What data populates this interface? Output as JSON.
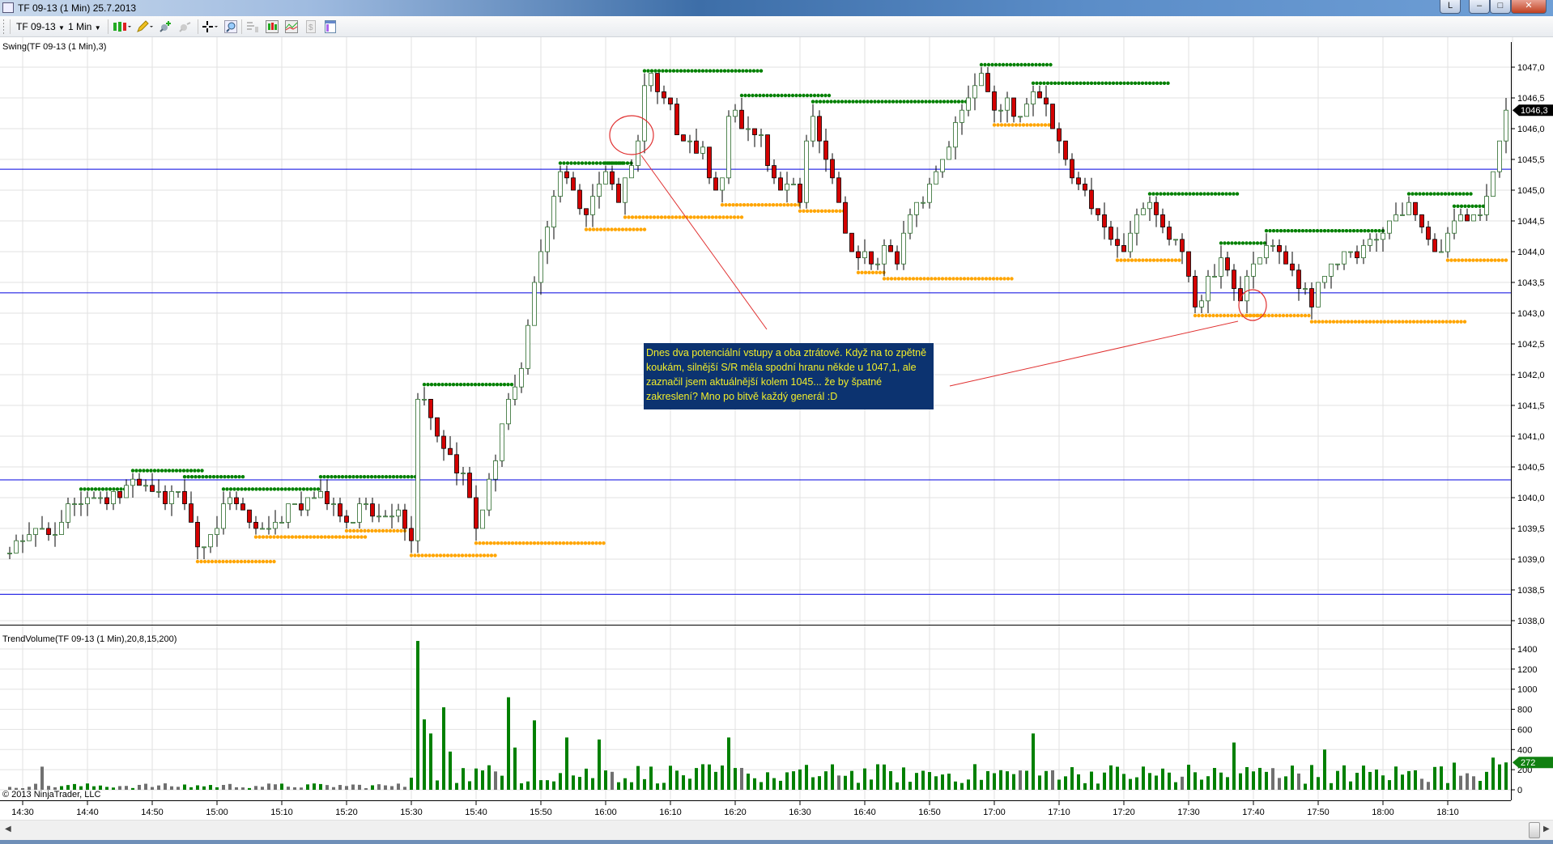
{
  "window": {
    "title": "TF 09-13 (1 Min)  25.7.2013",
    "btn_l": "L",
    "minimize": "–",
    "maximize": "□",
    "close": "✕"
  },
  "toolbar": {
    "instrument": "TF 09-13",
    "interval": "1 Min",
    "icons": [
      "bar-type-icon",
      "drawing-pencil-icon",
      "add-indicator-icon",
      "strategy-icon",
      "crosshair-icon",
      "zoom-icon",
      "data-box-icon",
      "chart-style-icon",
      "indicators-icon",
      "order-icon",
      "properties-icon"
    ]
  },
  "price_panel": {
    "label": "Swing(TF 09-13 (1 Min),3)",
    "last_price": "1046,3",
    "ticks": [
      "1047,0",
      "1046,5",
      "1046,0",
      "1045,5",
      "1045,0",
      "1044,5",
      "1044,0",
      "1043,5",
      "1043,0",
      "1042,5",
      "1042,0",
      "1041,5",
      "1041,0",
      "1040,5",
      "1040,0",
      "1039,5",
      "1039,0",
      "1038,5",
      "1038,0"
    ]
  },
  "volume_panel": {
    "label": "TrendVolume(TF 09-13 (1 Min),20,8,15,200)",
    "last_value": "272",
    "ticks": [
      "1400",
      "1200",
      "1000",
      "800",
      "600",
      "400",
      "200",
      "0"
    ]
  },
  "copyright": "© 2013 NinjaTrader, LLC",
  "time_axis": [
    "14:30",
    "14:40",
    "14:50",
    "15:00",
    "15:10",
    "15:20",
    "15:30",
    "15:40",
    "15:50",
    "16:00",
    "16:10",
    "16:20",
    "16:30",
    "16:40",
    "16:50",
    "17:00",
    "17:10",
    "17:20",
    "17:30",
    "17:40",
    "17:50",
    "18:00",
    "18:10"
  ],
  "annotation": "Dnes dva potenciální vstupy a oba ztrátové. Když na to zpětně koukám, silnější S/R měla spodní hranu někde u 1047,1, ale zaznačil jsem aktuálnější kolem 1045... že by špatné zakreslení? Mno po bitvě každý generál :D",
  "colors": {
    "up": "#ffffff",
    "down": "#d40000",
    "swing_high": "#008000",
    "swing_low": "#ffa500",
    "sr_line": "#0000e0",
    "vol_trend": "#008000",
    "vol_neutral": "#707070",
    "note_bg": "#0c3370",
    "note_text": "#f2ee2a"
  },
  "chart_data": {
    "type": "candlestick",
    "start_time": "14:28",
    "end_time": "18:19",
    "bar_minutes": 1,
    "price_range": [
      1038.0,
      1047.0
    ],
    "sr_levels": [
      1045.34,
      1043.33,
      1040.29,
      1038.43
    ],
    "close_keypoints_minute_price": [
      [
        -2,
        1039.1
      ],
      [
        0,
        1039.3
      ],
      [
        3,
        1039.5
      ],
      [
        5,
        1039.4
      ],
      [
        7,
        1039.9
      ],
      [
        10,
        1040.0
      ],
      [
        13,
        1039.9
      ],
      [
        16,
        1040.2
      ],
      [
        18,
        1040.2
      ],
      [
        21,
        1040.1
      ],
      [
        25,
        1039.9
      ],
      [
        27,
        1039.2
      ],
      [
        30,
        1039.5
      ],
      [
        32,
        1040.0
      ],
      [
        35,
        1039.6
      ],
      [
        38,
        1039.5
      ],
      [
        40,
        1039.6
      ],
      [
        42,
        1039.9
      ],
      [
        45,
        1040.0
      ],
      [
        48,
        1039.9
      ],
      [
        50,
        1039.6
      ],
      [
        52,
        1039.9
      ],
      [
        55,
        1039.7
      ],
      [
        58,
        1039.8
      ],
      [
        60,
        1039.3
      ],
      [
        61,
        1041.6
      ],
      [
        62,
        1041.6
      ],
      [
        64,
        1041.0
      ],
      [
        66,
        1040.7
      ],
      [
        68,
        1040.4
      ],
      [
        70,
        1039.5
      ],
      [
        72,
        1040.3
      ],
      [
        74,
        1041.2
      ],
      [
        76,
        1041.8
      ],
      [
        77,
        1042.1
      ],
      [
        78,
        1042.8
      ],
      [
        79,
        1043.5
      ],
      [
        80,
        1044.0
      ],
      [
        82,
        1044.9
      ],
      [
        83,
        1045.3
      ],
      [
        85,
        1045.0
      ],
      [
        87,
        1044.6
      ],
      [
        89,
        1045.1
      ],
      [
        90,
        1045.3
      ],
      [
        92,
        1044.8
      ],
      [
        94,
        1045.4
      ],
      [
        95,
        1045.8
      ],
      [
        96,
        1046.7
      ],
      [
        97,
        1046.9
      ],
      [
        98,
        1046.6
      ],
      [
        100,
        1046.4
      ],
      [
        101,
        1045.9
      ],
      [
        103,
        1045.8
      ],
      [
        105,
        1045.7
      ],
      [
        107,
        1045.0
      ],
      [
        108,
        1045.2
      ],
      [
        109,
        1046.2
      ],
      [
        110,
        1046.3
      ],
      [
        112,
        1046.0
      ],
      [
        114,
        1045.9
      ],
      [
        115,
        1045.4
      ],
      [
        117,
        1045.0
      ],
      [
        119,
        1045.1
      ],
      [
        120,
        1044.8
      ],
      [
        121,
        1045.8
      ],
      [
        122,
        1046.2
      ],
      [
        123,
        1045.8
      ],
      [
        125,
        1045.2
      ],
      [
        126,
        1044.8
      ],
      [
        127,
        1044.3
      ],
      [
        129,
        1043.9
      ],
      [
        130,
        1044.0
      ],
      [
        132,
        1043.8
      ],
      [
        133,
        1044.1
      ],
      [
        135,
        1043.8
      ],
      [
        136,
        1044.3
      ],
      [
        138,
        1044.8
      ],
      [
        140,
        1045.1
      ],
      [
        142,
        1045.5
      ],
      [
        144,
        1046.1
      ],
      [
        146,
        1046.5
      ],
      [
        148,
        1046.9
      ],
      [
        150,
        1046.3
      ],
      [
        152,
        1046.5
      ],
      [
        154,
        1046.2
      ],
      [
        156,
        1046.6
      ],
      [
        158,
        1046.4
      ],
      [
        159,
        1046.0
      ],
      [
        160,
        1045.8
      ],
      [
        162,
        1045.2
      ],
      [
        164,
        1045.0
      ],
      [
        166,
        1044.6
      ],
      [
        168,
        1044.2
      ],
      [
        170,
        1044.0
      ],
      [
        172,
        1044.6
      ],
      [
        174,
        1044.8
      ],
      [
        176,
        1044.4
      ],
      [
        178,
        1044.2
      ],
      [
        180,
        1043.6
      ],
      [
        181,
        1043.1
      ],
      [
        183,
        1043.6
      ],
      [
        185,
        1043.9
      ],
      [
        187,
        1043.4
      ],
      [
        188,
        1043.2
      ],
      [
        190,
        1043.8
      ],
      [
        192,
        1044.1
      ],
      [
        194,
        1044.0
      ],
      [
        196,
        1043.7
      ],
      [
        197,
        1043.4
      ],
      [
        199,
        1043.1
      ],
      [
        200,
        1043.5
      ],
      [
        202,
        1043.8
      ],
      [
        204,
        1044.0
      ],
      [
        206,
        1043.9
      ],
      [
        208,
        1044.2
      ],
      [
        210,
        1044.3
      ],
      [
        212,
        1044.6
      ],
      [
        214,
        1044.8
      ],
      [
        216,
        1044.4
      ],
      [
        218,
        1044.0
      ],
      [
        220,
        1044.3
      ],
      [
        222,
        1044.6
      ],
      [
        224,
        1044.6
      ],
      [
        226,
        1044.9
      ],
      [
        227,
        1045.3
      ],
      [
        228,
        1045.8
      ],
      [
        229,
        1046.3
      ]
    ],
    "volume_range": [
      0,
      1400
    ],
    "volume_spikes_minute_value": [
      [
        3,
        230
      ],
      [
        61,
        1480
      ],
      [
        62,
        700
      ],
      [
        63,
        560
      ],
      [
        65,
        820
      ],
      [
        66,
        380
      ],
      [
        75,
        920
      ],
      [
        76,
        420
      ],
      [
        79,
        690
      ],
      [
        84,
        520
      ],
      [
        89,
        500
      ],
      [
        109,
        520
      ],
      [
        156,
        560
      ],
      [
        187,
        470
      ],
      [
        201,
        400
      ],
      [
        221,
        270
      ],
      [
        227,
        320
      ],
      [
        229,
        272
      ]
    ]
  }
}
